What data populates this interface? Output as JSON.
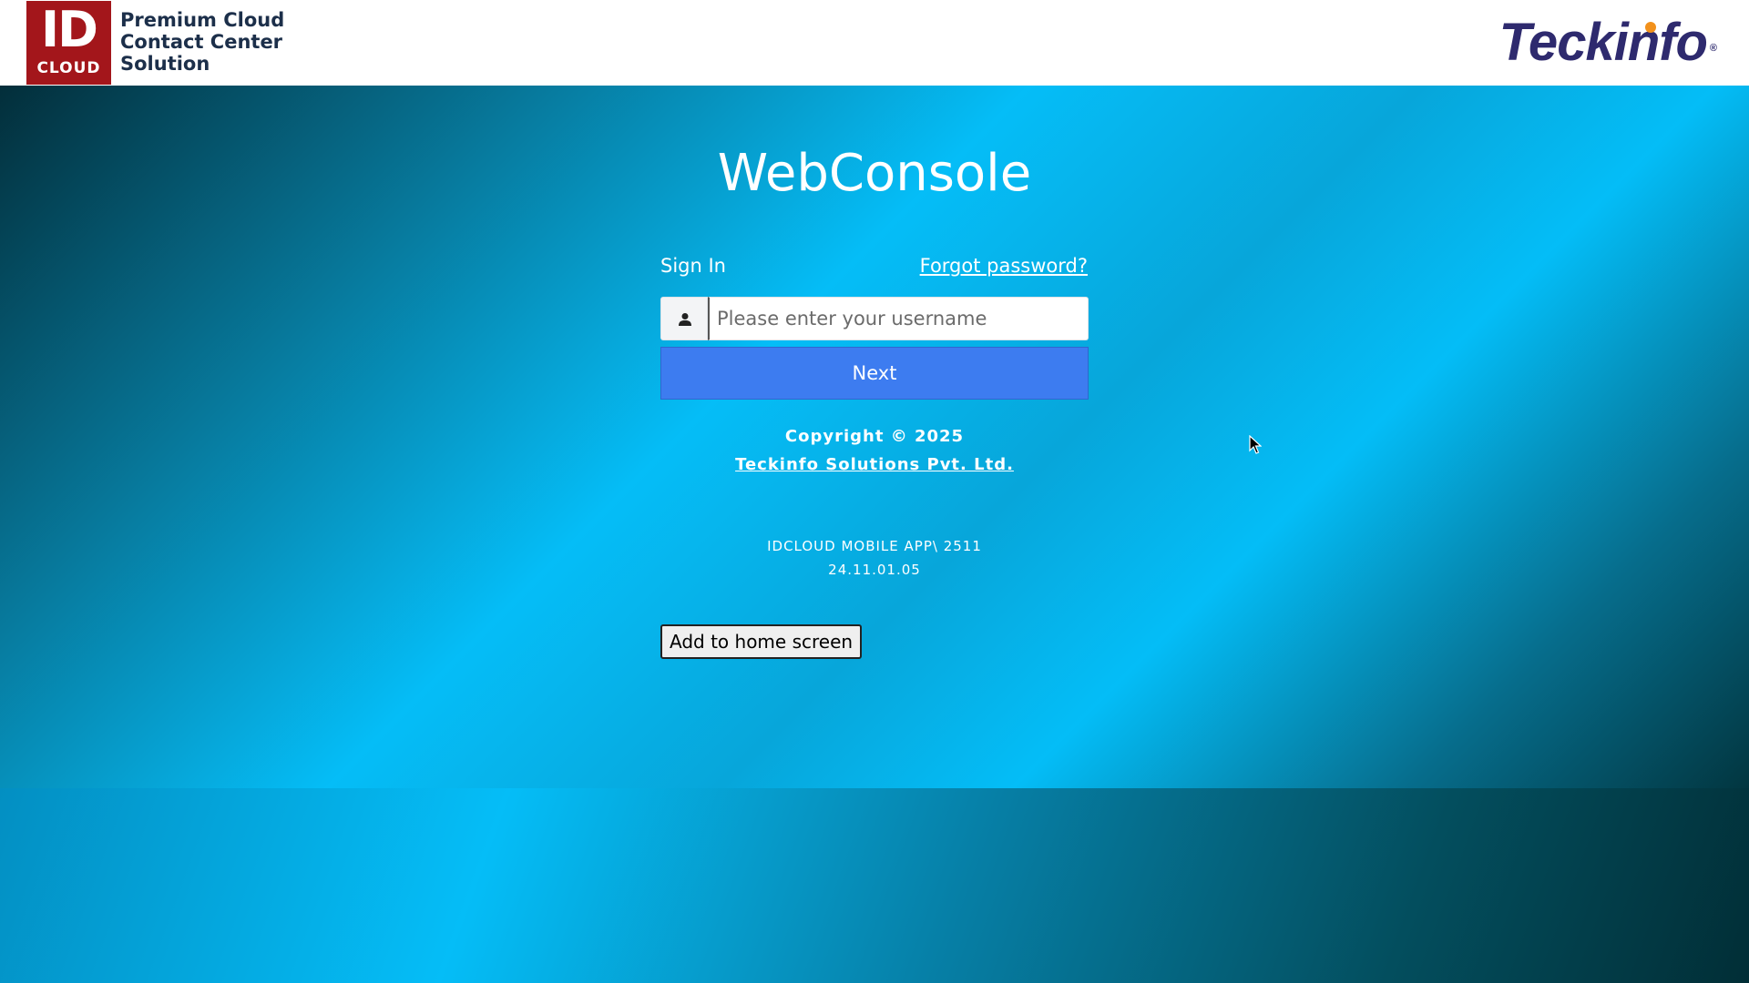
{
  "header": {
    "logo_big": "ID",
    "logo_small": "CLOUD",
    "tagline_lines": [
      "Premium Cloud",
      "Contact Center",
      "Solution"
    ],
    "brand_logo": "Teckinfo",
    "brand_reg": "®"
  },
  "main": {
    "title": "WebConsole",
    "signin_label": "Sign In",
    "forgot_password": "Forgot password?",
    "username_placeholder": "Please enter your username",
    "username_value": "",
    "next_label": "Next",
    "copyright": "Copyright © 2025",
    "company": "Teckinfo Solutions Pvt. Ltd.",
    "version_line1": "IDCLOUD MOBILE APP\\ 2511",
    "version_line2": "24.11.01.05",
    "add_home_label": "Add to home screen"
  },
  "icons": {
    "user": "user-icon",
    "cursor": "mouse-pointer-icon"
  },
  "colors": {
    "id_logo_red": "#a3161b",
    "tagline_navy": "#1c2f4a",
    "brand_navy": "#2e2a6e",
    "brand_orange": "#f2911b",
    "next_button_blue": "#3d7cf0",
    "bg_cyan": "#05bdf7",
    "bg_dark_teal": "#032e3a"
  }
}
